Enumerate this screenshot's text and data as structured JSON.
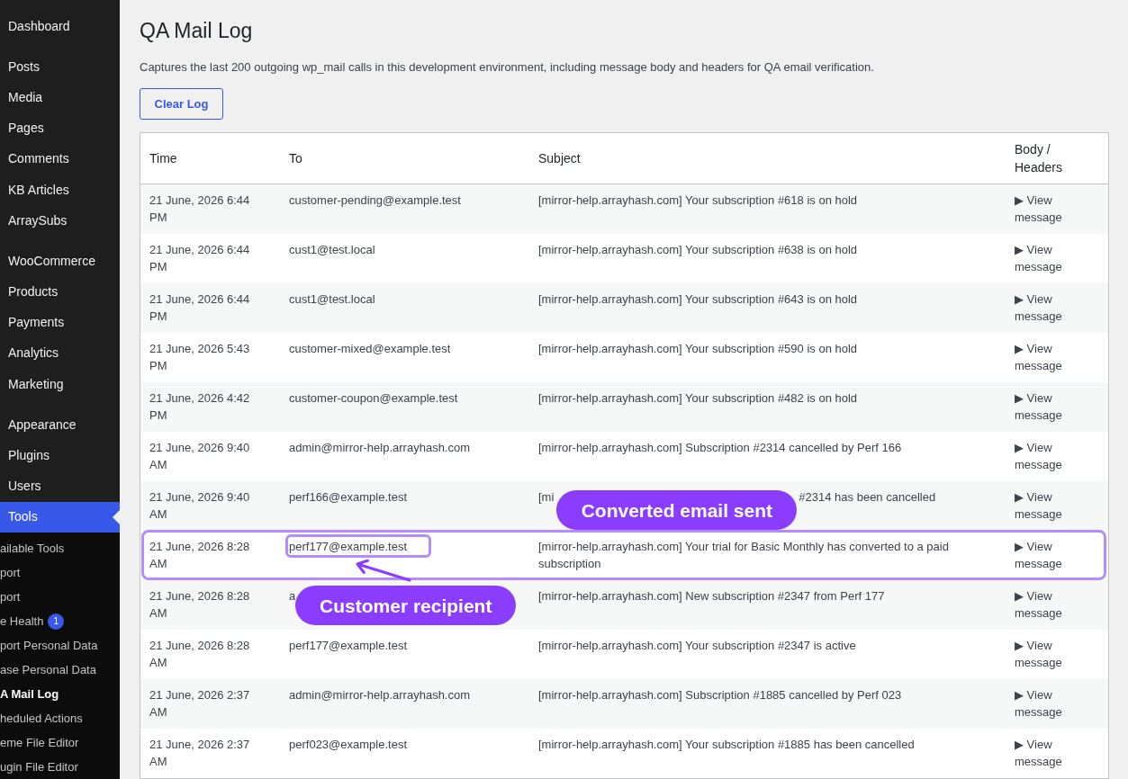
{
  "sidebar": {
    "groups": [
      {
        "items": [
          {
            "label": "Dashboard",
            "selected": false
          }
        ]
      },
      {
        "items": [
          {
            "label": "Posts",
            "selected": false
          },
          {
            "label": "Media",
            "selected": false
          },
          {
            "label": "Pages",
            "selected": false
          },
          {
            "label": "Comments",
            "selected": false
          },
          {
            "label": "KB Articles",
            "selected": false
          },
          {
            "label": "ArraySubs",
            "selected": false
          }
        ]
      },
      {
        "items": [
          {
            "label": "WooCommerce",
            "selected": false
          },
          {
            "label": "Products",
            "selected": false
          },
          {
            "label": "Payments",
            "selected": false
          },
          {
            "label": "Analytics",
            "selected": false
          },
          {
            "label": "Marketing",
            "selected": false
          }
        ]
      },
      {
        "items": [
          {
            "label": "Appearance",
            "selected": false
          },
          {
            "label": "Plugins",
            "selected": false
          },
          {
            "label": "Users",
            "selected": false
          },
          {
            "label": "Tools",
            "selected": true,
            "submenu": [
              {
                "label": "ailable Tools",
                "selected": false
              },
              {
                "label": "port",
                "selected": false
              },
              {
                "label": "port",
                "selected": false
              },
              {
                "label": "e Health",
                "selected": false,
                "badge": "1"
              },
              {
                "label": "port Personal Data",
                "selected": false
              },
              {
                "label": "ase Personal Data",
                "selected": false
              },
              {
                "label": "A Mail Log",
                "selected": true
              },
              {
                "label": "heduled Actions",
                "selected": false
              },
              {
                "label": "eme File Editor",
                "selected": false
              },
              {
                "label": "ugin File Editor",
                "selected": false
              }
            ]
          }
        ]
      }
    ]
  },
  "page": {
    "title": "QA Mail Log",
    "description": "Captures the last 200 outgoing wp_mail calls in this development environment, including message body and headers for QA email verification.",
    "clear_button": "Clear Log"
  },
  "table": {
    "columns": [
      "Time",
      "To",
      "Subject",
      "Body / Headers"
    ],
    "rows": [
      {
        "time": "21 June, 2026 6:44 PM",
        "to": "customer-pending@example.test",
        "subject": "[mirror-help.arrayhash.com] Your subscription #618 is on hold",
        "view": "▶ View message",
        "highlighted": false,
        "to_circled": false
      },
      {
        "time": "21 June, 2026 6:44 PM",
        "to": "cust1@test.local",
        "subject": "[mirror-help.arrayhash.com] Your subscription #638 is on hold",
        "view": "▶ View message",
        "highlighted": false,
        "to_circled": false
      },
      {
        "time": "21 June, 2026 6:44 PM",
        "to": "cust1@test.local",
        "subject": "[mirror-help.arrayhash.com] Your subscription #643 is on hold",
        "view": "▶ View message",
        "highlighted": false,
        "to_circled": false
      },
      {
        "time": "21 June, 2026 5:43 PM",
        "to": "customer-mixed@example.test",
        "subject": "[mirror-help.arrayhash.com] Your subscription #590 is on hold",
        "view": "▶ View message",
        "highlighted": false,
        "to_circled": false
      },
      {
        "time": "21 June, 2026 4:42 PM",
        "to": "customer-coupon@example.test",
        "subject": "[mirror-help.arrayhash.com] Your subscription #482 is on hold",
        "view": "▶ View message",
        "highlighted": false,
        "to_circled": false
      },
      {
        "time": "21 June, 2026 9:40 AM",
        "to": "admin@mirror-help.arrayhash.com",
        "subject": "[mirror-help.arrayhash.com] Subscription #2314 cancelled by Perf 166",
        "view": "▶ View message",
        "highlighted": false,
        "to_circled": false
      },
      {
        "time": "21 June, 2026 9:40 AM",
        "to": "perf166@example.test",
        "subject": "[mi",
        "subject_callout": "Converted email sent",
        "subject_rest": "#2314 has been cancelled",
        "view": "▶ View message",
        "highlighted": false,
        "to_circled": false
      },
      {
        "time": "21 June, 2026 8:28 AM",
        "to": "perf177@example.test",
        "subject": "[mirror-help.arrayhash.com] Your trial for Basic Monthly has converted to a paid subscription",
        "view": "▶ View message",
        "highlighted": true,
        "to_circled": true
      },
      {
        "time": "21 June, 2026 8:28 AM",
        "to": "a",
        "to_callout": "Customer recipient",
        "subject": "[mirror-help.arrayhash.com] New subscription #2347 from Perf 177",
        "view": "▶ View message",
        "highlighted": false,
        "to_circled": false
      },
      {
        "time": "21 June, 2026 8:28 AM",
        "to": "perf177@example.test",
        "subject": "[mirror-help.arrayhash.com] Your subscription #2347 is active",
        "view": "▶ View message",
        "highlighted": false,
        "to_circled": false
      },
      {
        "time": "21 June, 2026 2:37 AM",
        "to": "admin@mirror-help.arrayhash.com",
        "subject": "[mirror-help.arrayhash.com] Subscription #1885 cancelled by Perf 023",
        "view": "▶ View message",
        "highlighted": false,
        "to_circled": false
      },
      {
        "time": "21 June, 2026 2:37 AM",
        "to": "perf023@example.test",
        "subject": "[mirror-help.arrayhash.com] Your subscription #1885 has been cancelled",
        "view": "▶ View message",
        "highlighted": false,
        "to_circled": false
      }
    ]
  }
}
